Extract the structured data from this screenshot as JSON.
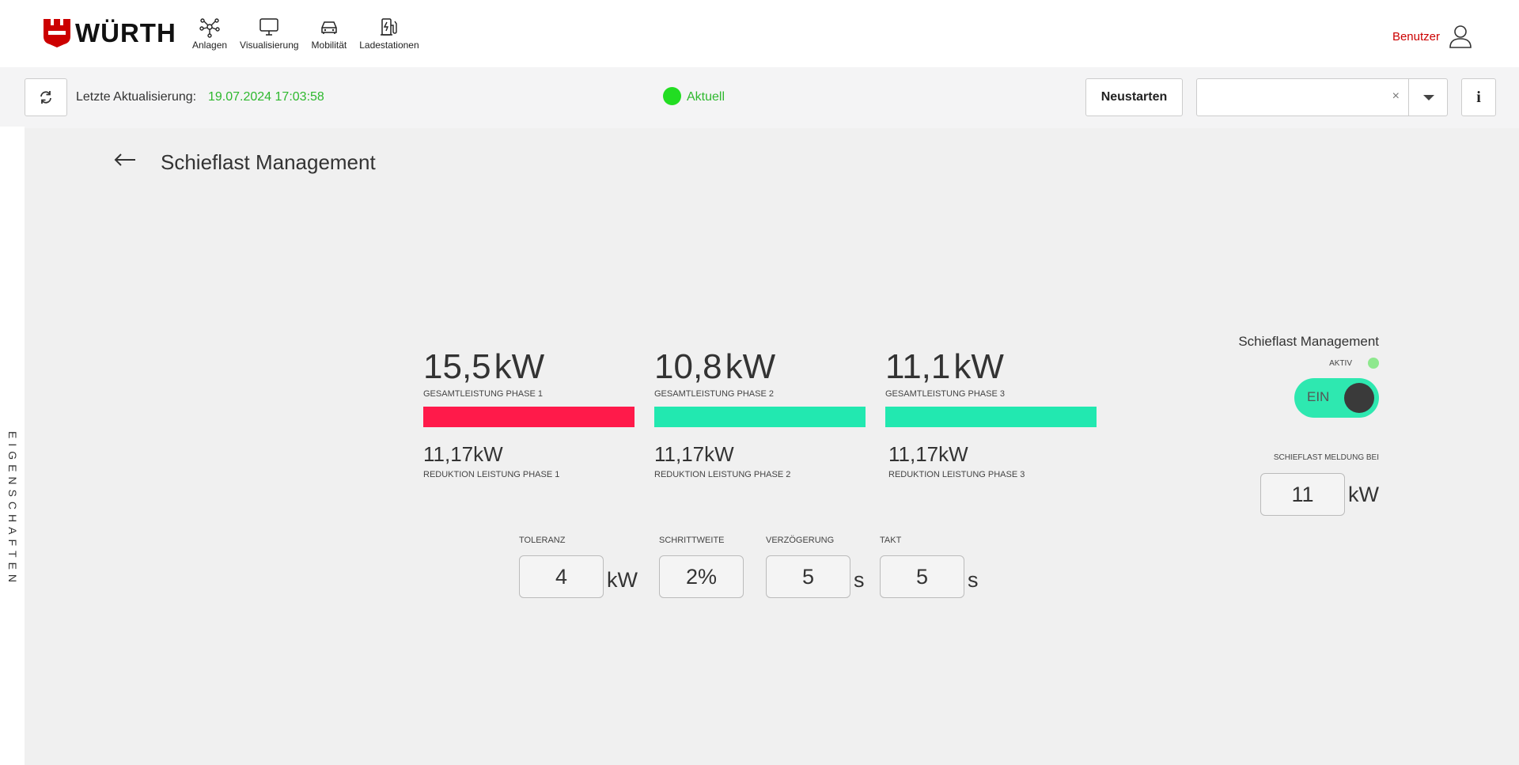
{
  "brand": {
    "name": "WÜRTH",
    "color": "#cc0000"
  },
  "nav": [
    {
      "label": "Anlagen",
      "icon": "network-icon"
    },
    {
      "label": "Visualisierung",
      "icon": "monitor-icon"
    },
    {
      "label": "Mobilität",
      "icon": "car-icon"
    },
    {
      "label": "Ladestationen",
      "icon": "charging-station-icon"
    }
  ],
  "user": {
    "label": "Benutzer"
  },
  "toolbar": {
    "last_update_label": "Letzte Aktualisierung:",
    "last_update_value": "19.07.2024 17:03:58",
    "status_label": "Aktuell",
    "status_color": "#22dd22",
    "restart_label": "Neustarten",
    "select_value": "",
    "clear_glyph": "×",
    "info_label": "i"
  },
  "side_tab": {
    "label": "EIGENSCHAFTEN"
  },
  "page": {
    "title": "Schieflast Management"
  },
  "phases": [
    {
      "value": "15,5",
      "unit": "kW",
      "caption": "GESAMTLEISTUNG PHASE 1",
      "bar_color": "#ff1a4a",
      "reduction_value": "11,17",
      "reduction_unit": "kW",
      "reduction_caption": "REDUKTION LEISTUNG PHASE 1"
    },
    {
      "value": "10,8",
      "unit": "kW",
      "caption": "GESAMTLEISTUNG PHASE 2",
      "bar_color": "#22e8b0",
      "reduction_value": "11,17",
      "reduction_unit": "kW",
      "reduction_caption": "REDUKTION LEISTUNG PHASE 2"
    },
    {
      "value": "11,1",
      "unit": "kW",
      "caption": "GESAMTLEISTUNG PHASE 3",
      "bar_color": "#22e8b0",
      "reduction_value": "11,17",
      "reduction_unit": "kW",
      "reduction_caption": "REDUKTION LEISTUNG PHASE 3"
    }
  ],
  "params": [
    {
      "caption": "TOLERANZ",
      "value": "4",
      "unit": "kW"
    },
    {
      "caption": "SCHRITTWEITE",
      "value": "2%",
      "unit": ""
    },
    {
      "caption": "VERZÖGERUNG",
      "value": "5",
      "unit": "s"
    },
    {
      "caption": "TAKT",
      "value": "5",
      "unit": "s"
    }
  ],
  "right_panel": {
    "title": "Schieflast Management",
    "aktiv_label": "AKTIV",
    "toggle_label": "EIN",
    "toggle_color": "#2ee8b0",
    "meldung_label": "SCHIEFLAST MELDUNG BEI",
    "meldung_value": "11",
    "meldung_unit": "kW"
  }
}
